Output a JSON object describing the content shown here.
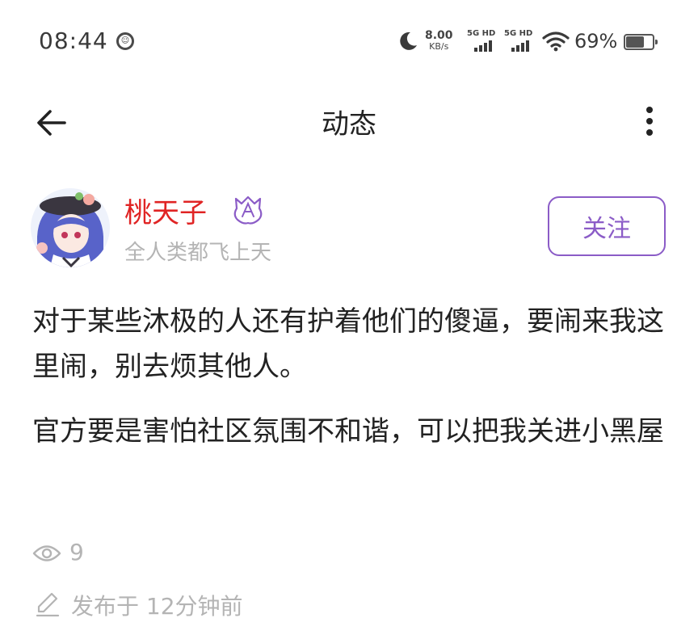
{
  "status_bar": {
    "time": "08:44",
    "net_speed_value": "8.00",
    "net_speed_unit": "KB/s",
    "sim1_label": "5G HD",
    "sim2_label": "5G HD",
    "battery_percent": "69%",
    "battery_level": 0.69,
    "icons": [
      "moon-icon",
      "wifi-icon",
      "battery-icon"
    ]
  },
  "header": {
    "title": "动态",
    "back_icon": "arrow-left-icon",
    "more_icon": "more-vertical-icon"
  },
  "author": {
    "name": "桃天子",
    "bio": "全人类都飞上天",
    "name_color": "#e02424",
    "follow_label": "关注",
    "accent_color": "#8b5cc7"
  },
  "content": {
    "paragraphs": [
      "对于某些沐极的人还有护着他们的傻逼，要闹来我这里闹，别去烦其他人。",
      "官方要是害怕社区氛围不和谐，可以把我关进小黑屋"
    ]
  },
  "meta": {
    "views": "9",
    "published": "发布于 12分钟前"
  }
}
